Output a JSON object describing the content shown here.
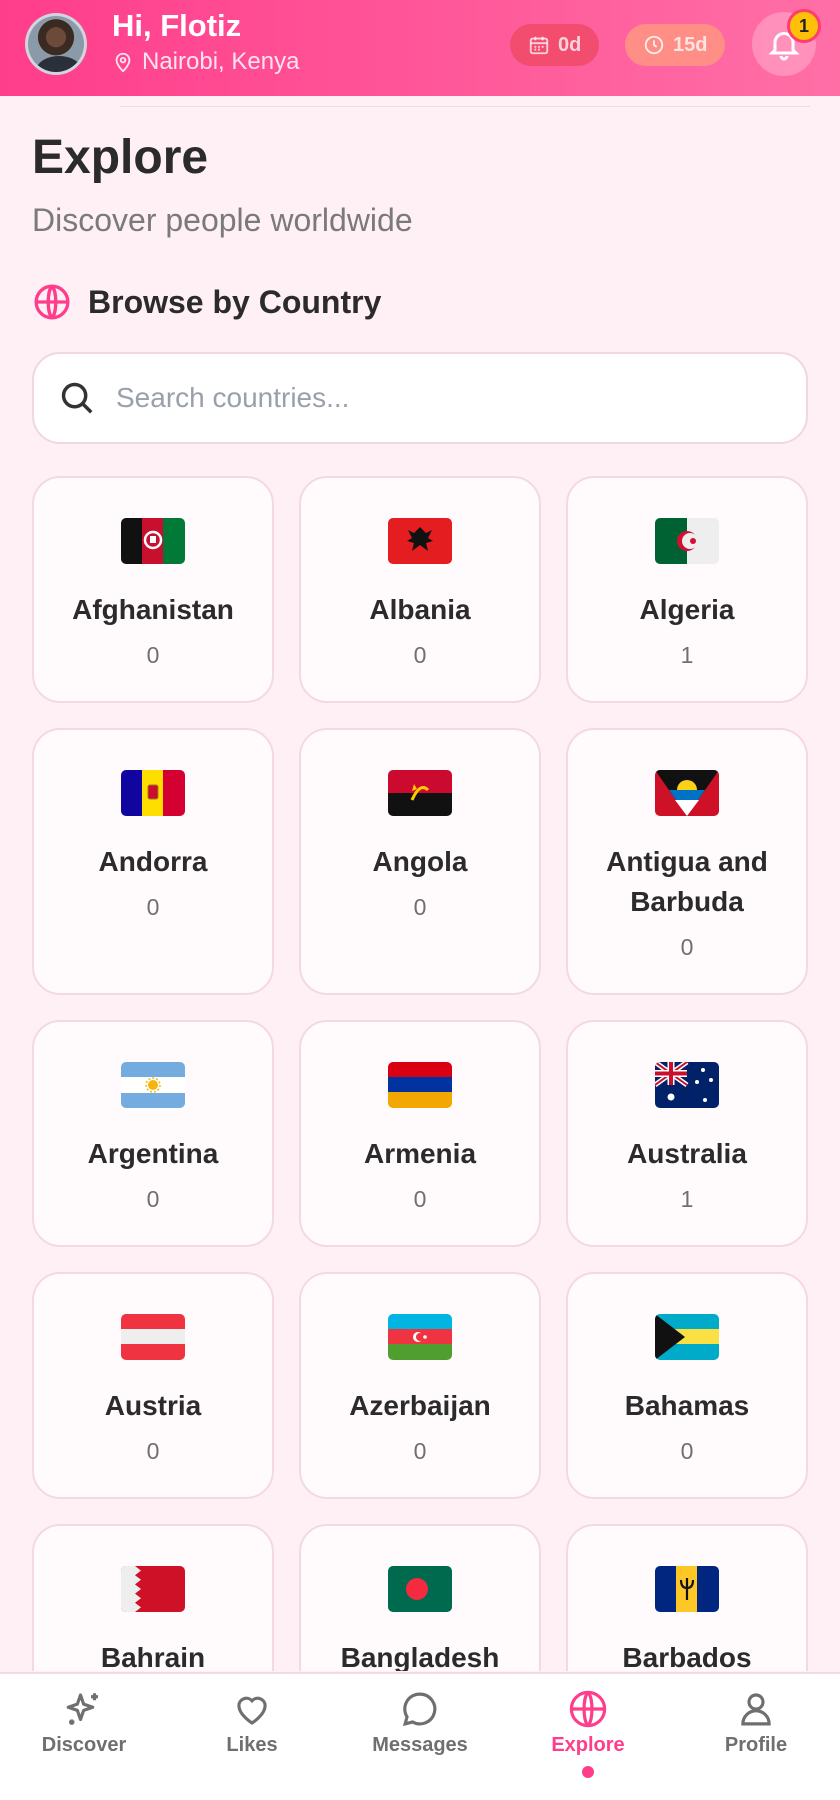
{
  "header": {
    "greeting": "Hi, Flotiz",
    "location": "Nairobi, Kenya",
    "days_pill": "0d",
    "time_pill": "15d",
    "notification_count": "1"
  },
  "page": {
    "title": "Explore",
    "subtitle": "Discover people worldwide",
    "section_label": "Browse by Country"
  },
  "search": {
    "placeholder": "Search countries...",
    "value": ""
  },
  "countries": [
    {
      "name": "Afghanistan",
      "count": "0"
    },
    {
      "name": "Albania",
      "count": "0"
    },
    {
      "name": "Algeria",
      "count": "1"
    },
    {
      "name": "Andorra",
      "count": "0"
    },
    {
      "name": "Angola",
      "count": "0"
    },
    {
      "name": "Antigua and Barbuda",
      "count": "0"
    },
    {
      "name": "Argentina",
      "count": "0"
    },
    {
      "name": "Armenia",
      "count": "0"
    },
    {
      "name": "Australia",
      "count": "1"
    },
    {
      "name": "Austria",
      "count": "0"
    },
    {
      "name": "Azerbaijan",
      "count": "0"
    },
    {
      "name": "Bahamas",
      "count": "0"
    },
    {
      "name": "Bahrain",
      "count": ""
    },
    {
      "name": "Bangladesh",
      "count": ""
    },
    {
      "name": "Barbados",
      "count": ""
    }
  ],
  "nav": {
    "items": [
      {
        "label": "Discover",
        "icon": "sparkles-icon"
      },
      {
        "label": "Likes",
        "icon": "heart-icon"
      },
      {
        "label": "Messages",
        "icon": "chat-bubble-icon"
      },
      {
        "label": "Explore",
        "icon": "globe-icon",
        "active": true
      },
      {
        "label": "Profile",
        "icon": "user-icon"
      }
    ]
  },
  "colors": {
    "accent": "#ff3d8b",
    "background": "#fff0f5",
    "badge": "#ffc107"
  }
}
